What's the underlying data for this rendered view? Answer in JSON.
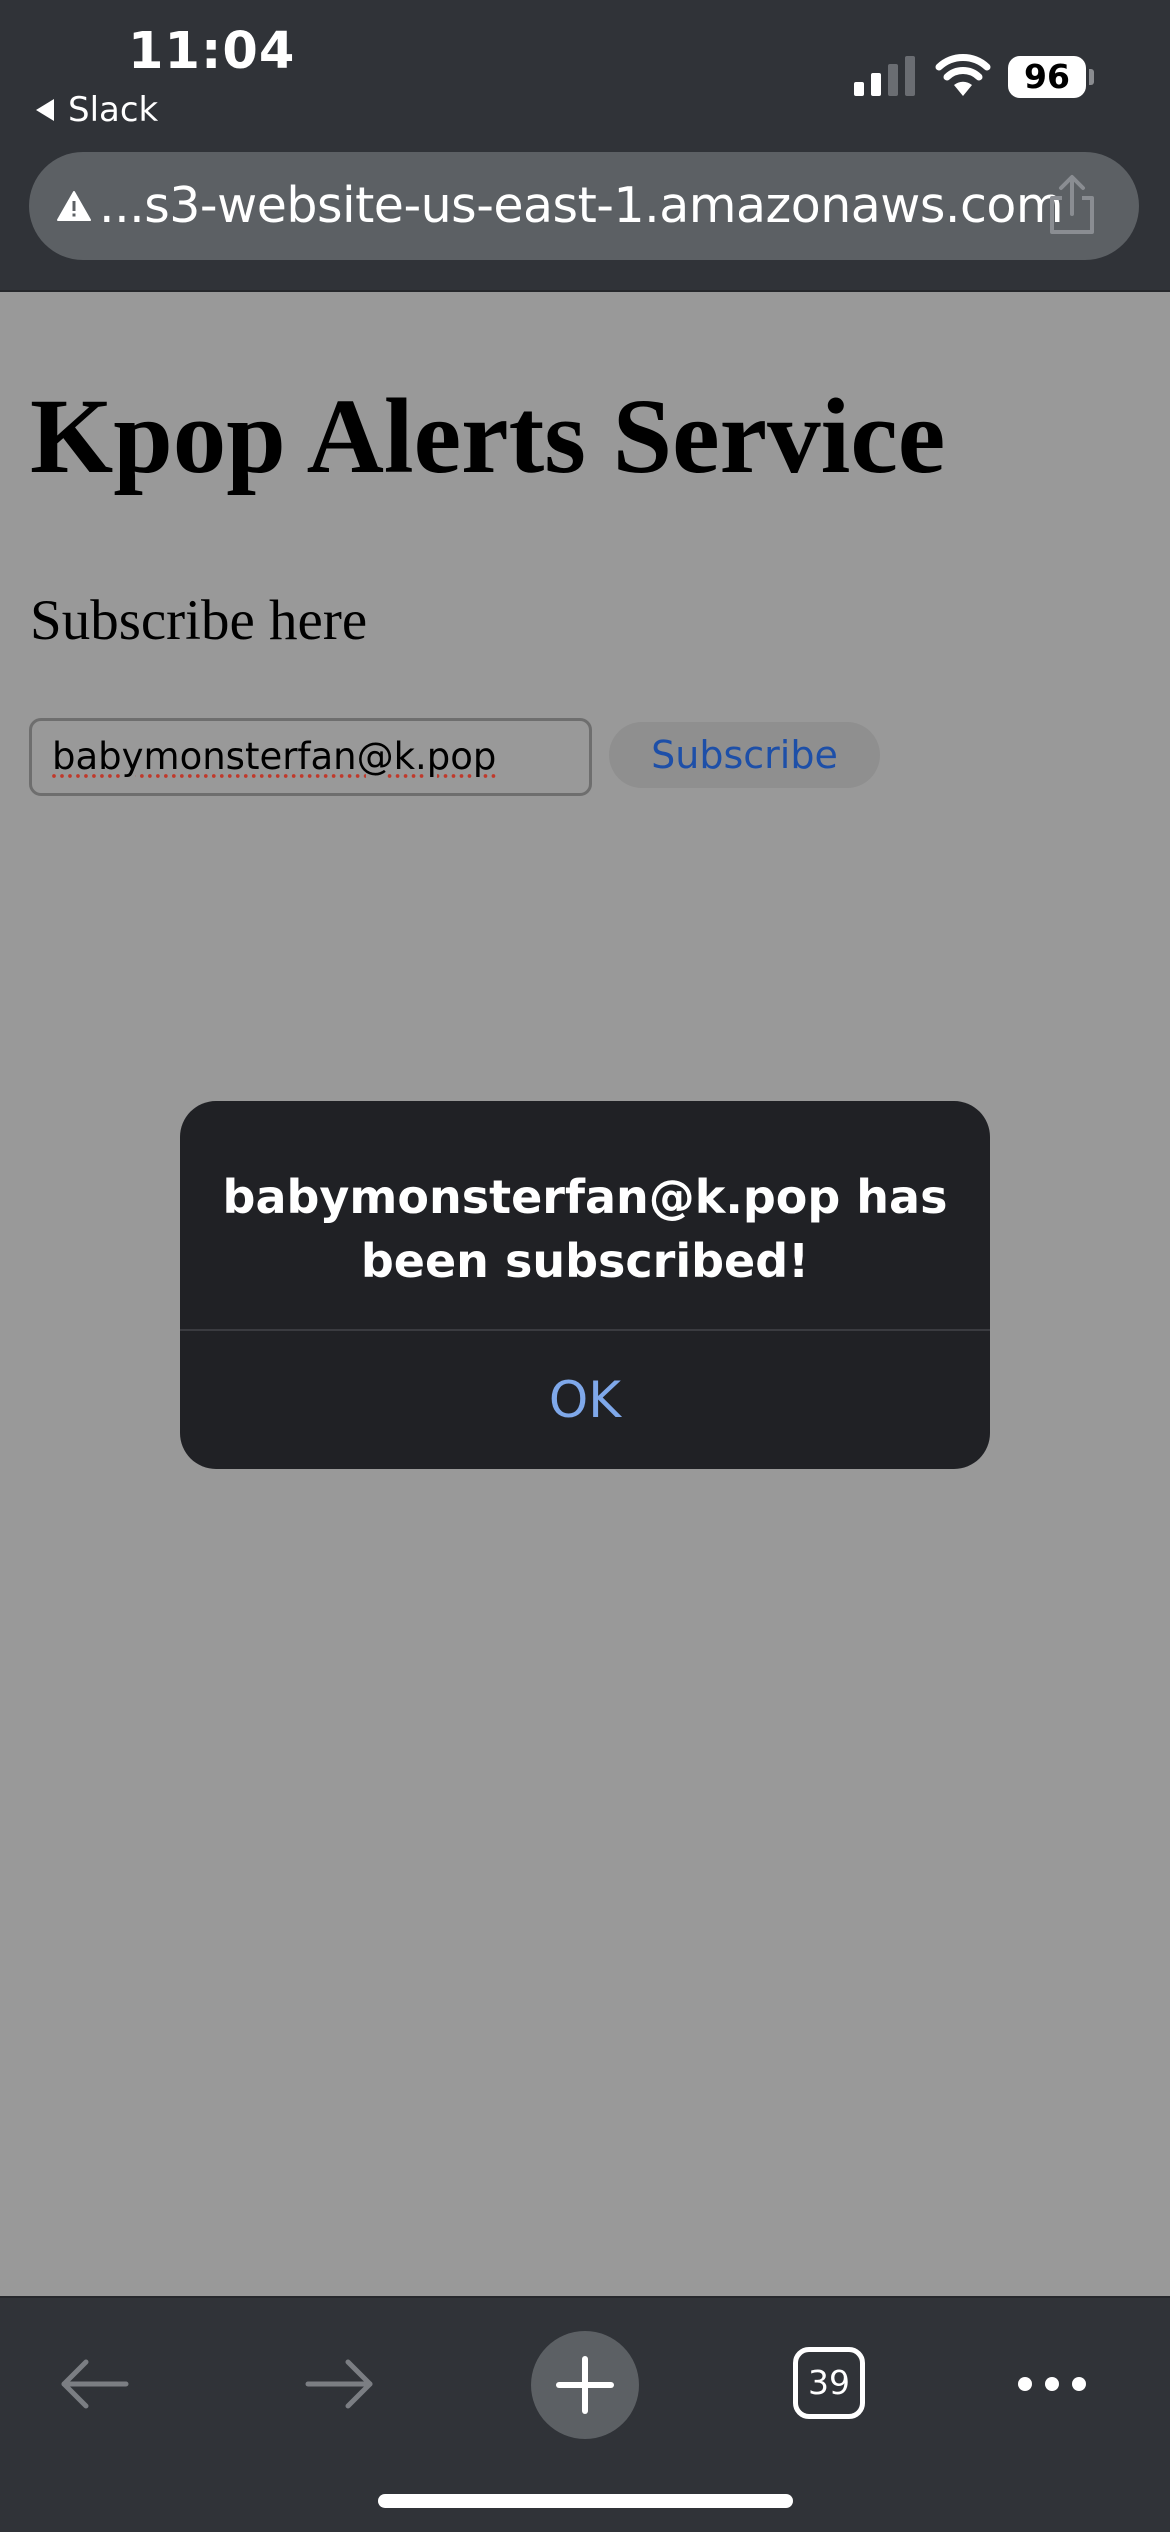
{
  "status_bar": {
    "time": "11:04",
    "back_app": "Slack",
    "battery": "96"
  },
  "browser": {
    "url": "...s3-website-us-east-1.amazonaws.com",
    "tab_count": "39"
  },
  "page": {
    "title": "Kpop Alerts Service",
    "subscribe_heading": "Subscribe here",
    "email_value": "babymonsterfan@k.pop",
    "subscribe_button": "Subscribe"
  },
  "alert": {
    "message": "babymonsterfan@k.pop has been subscribed!",
    "ok_label": "OK"
  },
  "icons": {
    "warning": "warning-icon",
    "share": "share-icon",
    "back": "arrow-left-icon",
    "forward": "arrow-right-icon",
    "new_tab": "plus-icon",
    "more": "ellipsis-icon"
  }
}
